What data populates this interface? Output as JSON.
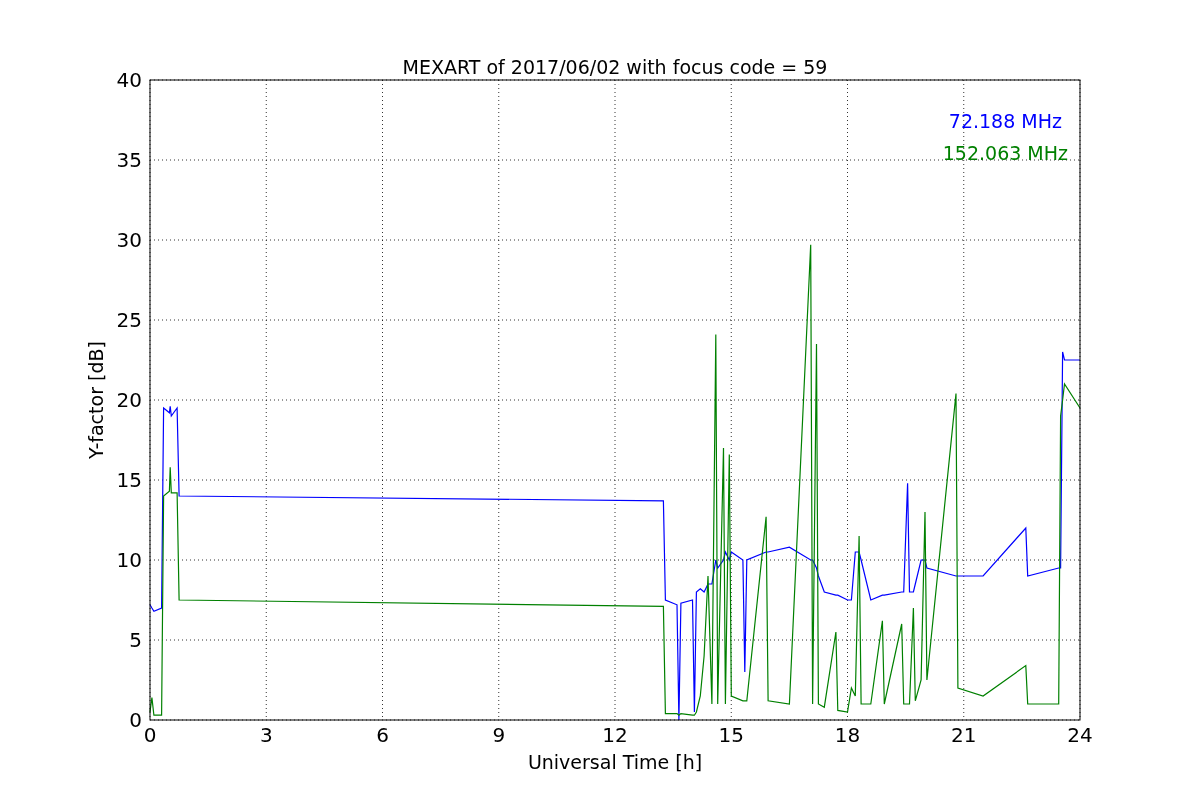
{
  "chart_data": {
    "type": "line",
    "title": "MEXART of 2017/06/02 with focus code = 59",
    "xlabel": "Universal Time [h]",
    "ylabel": "Y-factor [dB]",
    "x": [
      0,
      0.05,
      0.1,
      0.3,
      0.35,
      0.5,
      0.52,
      0.55,
      0.7,
      0.75,
      13.25,
      13.3,
      13.6,
      13.65,
      13.7,
      14.0,
      14.05,
      14.1,
      14.2,
      14.3,
      14.4,
      14.5,
      14.6,
      14.65,
      14.8,
      14.85,
      14.95,
      15.0,
      15.3,
      15.35,
      15.4,
      15.9,
      15.95,
      16.5,
      17.05,
      17.1,
      17.2,
      17.25,
      17.4,
      17.7,
      17.75,
      18.0,
      18.1,
      18.2,
      18.3,
      18.35,
      18.6,
      18.9,
      18.95,
      19.4,
      19.45,
      19.55,
      19.6,
      19.7,
      19.75,
      19.9,
      20.0,
      20.05,
      20.8,
      20.85,
      21.5,
      22.6,
      22.65,
      23.45,
      23.5,
      23.55,
      23.6,
      24
    ],
    "series": [
      {
        "name": "72.188 MHz",
        "color": "#0000ff",
        "values": [
          7.2,
          7.0,
          6.8,
          7.0,
          19.5,
          19.2,
          19.6,
          19.0,
          19.5,
          14.0,
          13.7,
          7.5,
          7.2,
          0.0,
          7.3,
          7.5,
          0.5,
          8.0,
          8.2,
          8.0,
          8.5,
          8.5,
          10.0,
          9.5,
          10.0,
          10.5,
          10.0,
          10.5,
          10.0,
          3.0,
          10.0,
          10.5,
          10.5,
          10.8,
          10.0,
          10.0,
          9.5,
          9.0,
          8.0,
          7.8,
          7.8,
          7.5,
          7.5,
          10.5,
          10.5,
          10.0,
          7.5,
          7.8,
          7.8,
          8.0,
          8.0,
          14.8,
          8.0,
          8.0,
          8.5,
          10.0,
          10.0,
          9.5,
          9.0,
          9.0,
          9.0,
          12.0,
          9.0,
          9.5,
          9.5,
          23.0,
          22.5,
          22.5
        ]
      },
      {
        "name": "152.063 MHz",
        "color": "#008000",
        "values": [
          0.5,
          1.4,
          0.3,
          0.3,
          14.0,
          14.3,
          15.8,
          14.2,
          14.2,
          7.5,
          7.1,
          0.4,
          0.4,
          0.3,
          0.4,
          0.3,
          0.3,
          0.5,
          1.5,
          4.0,
          9.0,
          1.0,
          24.1,
          1.0,
          17.0,
          1.0,
          16.6,
          1.5,
          1.2,
          1.2,
          1.2,
          12.7,
          1.2,
          1.0,
          29.7,
          1.0,
          23.5,
          1.0,
          0.8,
          5.5,
          0.6,
          0.5,
          2.0,
          1.5,
          11.5,
          1.0,
          1.0,
          6.2,
          1.0,
          6.0,
          1.0,
          1.0,
          1.0,
          7.0,
          1.2,
          2.5,
          13.0,
          2.5,
          20.4,
          2.0,
          1.5,
          3.4,
          1.0,
          1.0,
          19.0,
          20.0,
          21.0,
          19.5
        ]
      }
    ],
    "grid": true,
    "xlim": [
      0,
      24
    ],
    "ylim": [
      0,
      40
    ],
    "xticks": [
      0,
      3,
      6,
      9,
      12,
      15,
      18,
      21,
      24
    ],
    "yticks": [
      0,
      5,
      10,
      15,
      20,
      25,
      30,
      35,
      40
    ]
  }
}
